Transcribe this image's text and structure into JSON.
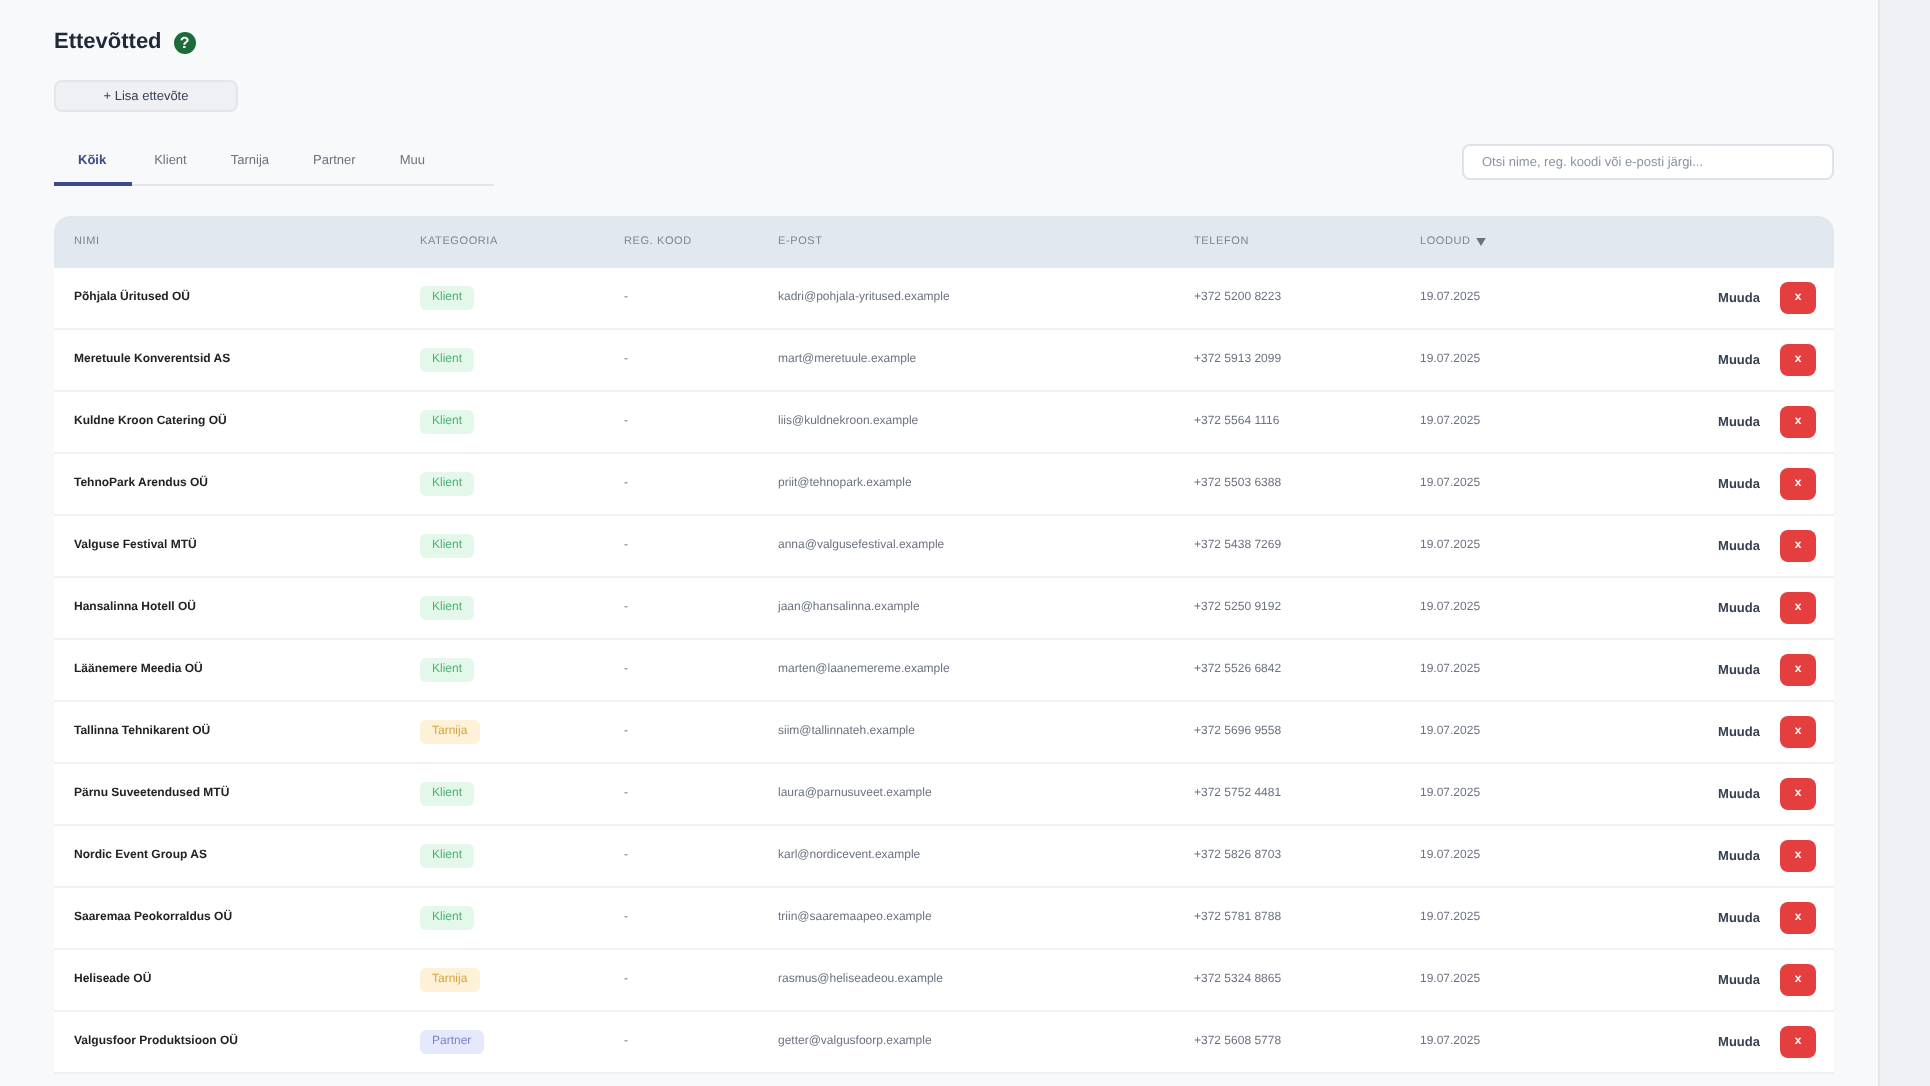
{
  "page": {
    "title": "Ettevõtted",
    "help": "?"
  },
  "add_button": "+ Lisa ettevõte",
  "tabs": [
    {
      "label": "Kõik",
      "selected": true
    },
    {
      "label": "Klient",
      "selected": false
    },
    {
      "label": "Tarnija",
      "selected": false
    },
    {
      "label": "Partner",
      "selected": false
    },
    {
      "label": "Muu",
      "selected": false
    }
  ],
  "search": {
    "placeholder": "Otsi nime, reg. koodi või e-posti järgi..."
  },
  "table": {
    "columns": [
      {
        "label": "NIMI",
        "sorted": false
      },
      {
        "label": "KATEGOORIA",
        "sorted": false
      },
      {
        "label": "REG. KOOD",
        "sorted": false
      },
      {
        "label": "E-POST",
        "sorted": false
      },
      {
        "label": "TELEFON",
        "sorted": false
      },
      {
        "label": "LOODUD",
        "sorted": true
      }
    ],
    "rows": [
      {
        "name": "Põhjala Üritused OÜ",
        "category": "Klient",
        "kind": "client",
        "reg": "-",
        "email": "kadri@pohjala-yritused.example",
        "phone": "+372 5200 8223",
        "created": "19.07.2025",
        "edit": "Muuda",
        "delete": "x"
      },
      {
        "name": "Meretuule Konverentsid AS",
        "category": "Klient",
        "kind": "client",
        "reg": "-",
        "email": "mart@meretuule.example",
        "phone": "+372 5913 2099",
        "created": "19.07.2025",
        "edit": "Muuda",
        "delete": "x"
      },
      {
        "name": "Kuldne Kroon Catering OÜ",
        "category": "Klient",
        "kind": "client",
        "reg": "-",
        "email": "liis@kuldnekroon.example",
        "phone": "+372 5564 1116",
        "created": "19.07.2025",
        "edit": "Muuda",
        "delete": "x"
      },
      {
        "name": "TehnoPark Arendus OÜ",
        "category": "Klient",
        "kind": "client",
        "reg": "-",
        "email": "priit@tehnopark.example",
        "phone": "+372 5503 6388",
        "created": "19.07.2025",
        "edit": "Muuda",
        "delete": "x"
      },
      {
        "name": "Valguse Festival MTÜ",
        "category": "Klient",
        "kind": "client",
        "reg": "-",
        "email": "anna@valgusefestival.example",
        "phone": "+372 5438 7269",
        "created": "19.07.2025",
        "edit": "Muuda",
        "delete": "x"
      },
      {
        "name": "Hansalinna Hotell OÜ",
        "category": "Klient",
        "kind": "client",
        "reg": "-",
        "email": "jaan@hansalinna.example",
        "phone": "+372 5250 9192",
        "created": "19.07.2025",
        "edit": "Muuda",
        "delete": "x"
      },
      {
        "name": "Läänemere Meedia OÜ",
        "category": "Klient",
        "kind": "client",
        "reg": "-",
        "email": "marten@laanemereme.example",
        "phone": "+372 5526 6842",
        "created": "19.07.2025",
        "edit": "Muuda",
        "delete": "x"
      },
      {
        "name": "Tallinna Tehnikarent OÜ",
        "category": "Tarnija",
        "kind": "supplier",
        "reg": "-",
        "email": "siim@tallinnateh.example",
        "phone": "+372 5696 9558",
        "created": "19.07.2025",
        "edit": "Muuda",
        "delete": "x"
      },
      {
        "name": "Pärnu Suveetendused MTÜ",
        "category": "Klient",
        "kind": "client",
        "reg": "-",
        "email": "laura@parnusuveet.example",
        "phone": "+372 5752 4481",
        "created": "19.07.2025",
        "edit": "Muuda",
        "delete": "x"
      },
      {
        "name": "Nordic Event Group AS",
        "category": "Klient",
        "kind": "client",
        "reg": "-",
        "email": "karl@nordicevent.example",
        "phone": "+372 5826 8703",
        "created": "19.07.2025",
        "edit": "Muuda",
        "delete": "x"
      },
      {
        "name": "Saaremaa Peokorraldus OÜ",
        "category": "Klient",
        "kind": "client",
        "reg": "-",
        "email": "triin@saaremaapeo.example",
        "phone": "+372 5781 8788",
        "created": "19.07.2025",
        "edit": "Muuda",
        "delete": "x"
      },
      {
        "name": "Heliseade OÜ",
        "category": "Tarnija",
        "kind": "supplier",
        "reg": "-",
        "email": "rasmus@heliseadeou.example",
        "phone": "+372 5324 8865",
        "created": "19.07.2025",
        "edit": "Muuda",
        "delete": "x"
      },
      {
        "name": "Valgusfoor Produktsioon OÜ",
        "category": "Partner",
        "kind": "partner",
        "reg": "-",
        "email": "getter@valgusfoorp.example",
        "phone": "+372 5608 5778",
        "created": "19.07.2025",
        "edit": "Muuda",
        "delete": "x"
      }
    ]
  }
}
